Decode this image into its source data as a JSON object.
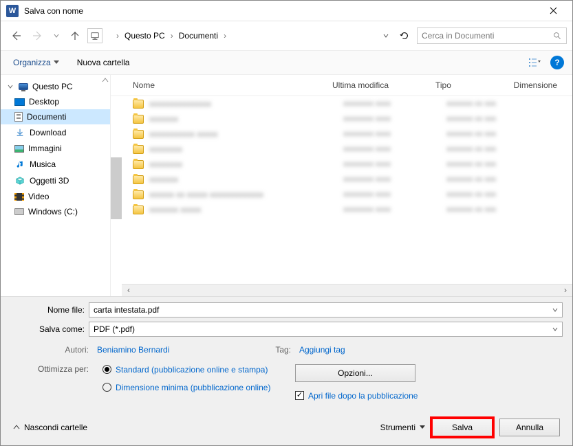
{
  "titlebar": {
    "app_glyph": "W",
    "title": "Salva con nome"
  },
  "breadcrumb": {
    "items": [
      "Questo PC",
      "Documenti"
    ]
  },
  "search": {
    "placeholder": "Cerca in Documenti"
  },
  "toolbar": {
    "organize": "Organizza",
    "new_folder": "Nuova cartella",
    "help_glyph": "?"
  },
  "tree": {
    "root": "Questo PC",
    "items": [
      {
        "label": "Desktop",
        "icon": "desktop"
      },
      {
        "label": "Documenti",
        "icon": "doc",
        "selected": true
      },
      {
        "label": "Download",
        "icon": "download"
      },
      {
        "label": "Immagini",
        "icon": "img"
      },
      {
        "label": "Musica",
        "icon": "music"
      },
      {
        "label": "Oggetti 3D",
        "icon": "obj3d"
      },
      {
        "label": "Video",
        "icon": "video"
      },
      {
        "label": "Windows (C:)",
        "icon": "drive"
      }
    ]
  },
  "columns": {
    "name": "Nome",
    "modified": "Ultima modifica",
    "type": "Tipo",
    "size": "Dimensione"
  },
  "rows": [
    {
      "name": "xxxxxxxxxxxxxxx",
      "mod": "xxxxxxxx xxxx",
      "type": "xxxxxxx xx xxx"
    },
    {
      "name": "xxxxxxx",
      "mod": "xxxxxxxx xxxx",
      "type": "xxxxxxx xx xxx"
    },
    {
      "name": "xxxxxxxxxxx xxxxx",
      "mod": "xxxxxxxx xxxx",
      "type": "xxxxxxx xx xxx"
    },
    {
      "name": "xxxxxxxx",
      "mod": "xxxxxxxx xxxx",
      "type": "xxxxxxx xx xxx"
    },
    {
      "name": "xxxxxxxx",
      "mod": "xxxxxxxx xxxx",
      "type": "xxxxxxx xx xxx"
    },
    {
      "name": "xxxxxxx",
      "mod": "xxxxxxxx xxxx",
      "type": "xxxxxxx xx xxx"
    },
    {
      "name": "xxxxxx xx xxxxx xxxxxxxxxxxxx",
      "mod": "xxxxxxxx xxxx",
      "type": "xxxxxxx xx xxx"
    },
    {
      "name": "xxxxxxx xxxxx",
      "mod": "xxxxxxxx xxxx",
      "type": "xxxxxxx xx xxx"
    }
  ],
  "form": {
    "filename_label": "Nome file:",
    "filename_value": "carta intestata.pdf",
    "saveas_label": "Salva come:",
    "saveas_value": "PDF (*.pdf)",
    "authors_label": "Autori:",
    "authors_value": "Beniamino Bernardi",
    "tags_label": "Tag:",
    "tags_value": "Aggiungi tag",
    "optimize_label": "Ottimizza per:",
    "radio1": "Standard (pubblicazione online e stampa)",
    "radio2": "Dimensione minima (pubblicazione online)",
    "options_btn": "Opzioni...",
    "open_after": "Apri file dopo la pubblicazione"
  },
  "footer": {
    "hide_folders": "Nascondi cartelle",
    "tools": "Strumenti",
    "save": "Salva",
    "cancel": "Annulla"
  }
}
